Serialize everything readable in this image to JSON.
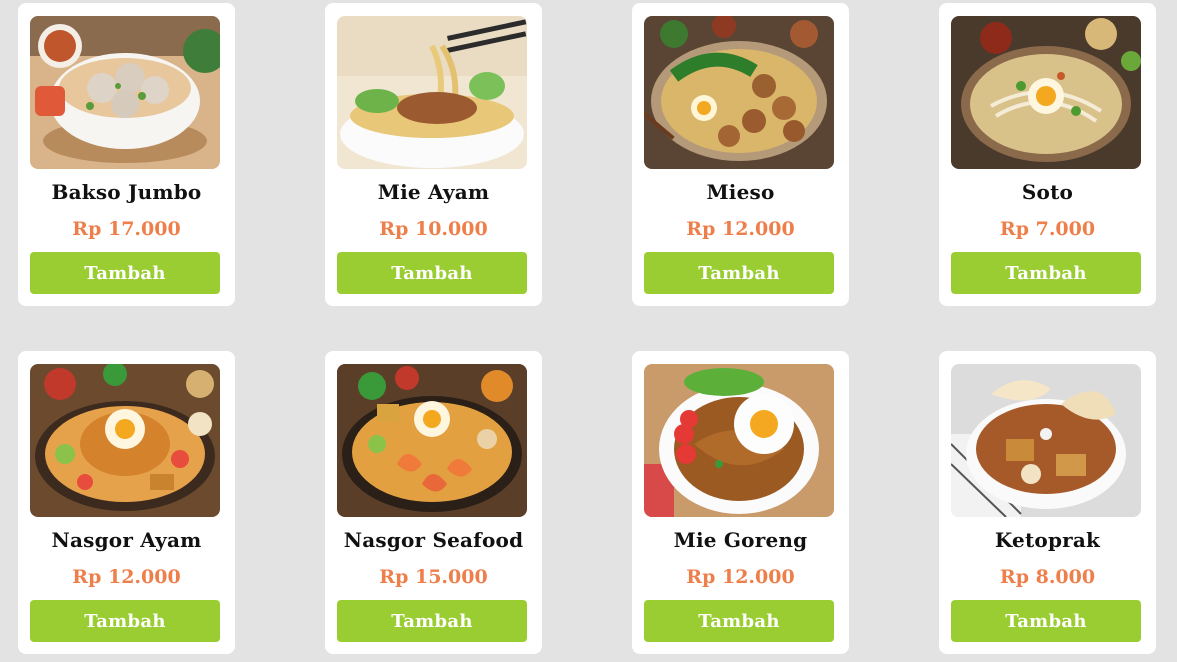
{
  "menu": [
    {
      "name": "Bakso Jumbo",
      "price": "Rp 17.000",
      "button": "Tambah",
      "image_icon": "bakso-photo-icon"
    },
    {
      "name": "Mie Ayam",
      "price": "Rp 10.000",
      "button": "Tambah",
      "image_icon": "mie-ayam-photo-icon"
    },
    {
      "name": "Mieso",
      "price": "Rp 12.000",
      "button": "Tambah",
      "image_icon": "mieso-photo-icon"
    },
    {
      "name": "Soto",
      "price": "Rp 7.000",
      "button": "Tambah",
      "image_icon": "soto-photo-icon"
    },
    {
      "name": "Nasgor Ayam",
      "price": "Rp 12.000",
      "button": "Tambah",
      "image_icon": "nasgor-ayam-photo-icon"
    },
    {
      "name": "Nasgor Seafood",
      "price": "Rp 15.000",
      "button": "Tambah",
      "image_icon": "nasgor-seafood-photo-icon"
    },
    {
      "name": "Mie Goreng",
      "price": "Rp 12.000",
      "button": "Tambah",
      "image_icon": "mie-goreng-photo-icon"
    },
    {
      "name": "Ketoprak",
      "price": "Rp 8.000",
      "button": "Tambah",
      "image_icon": "ketoprak-photo-icon"
    }
  ],
  "colors": {
    "background": "#e3e3e3",
    "card": "#ffffff",
    "price": "#ee7f4b",
    "button": "#9acd32",
    "button_text": "#ffffff"
  }
}
